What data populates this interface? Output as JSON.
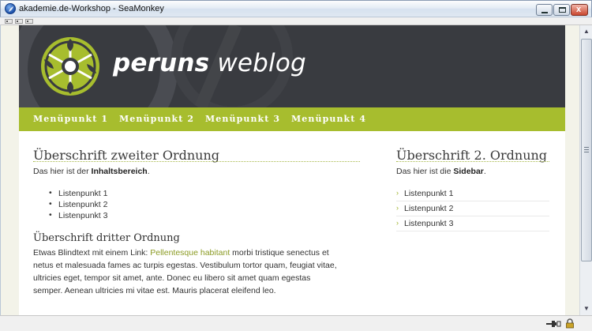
{
  "window": {
    "title": "akademie.de-Workshop - SeaMonkey",
    "close_glyph": "x"
  },
  "site": {
    "title_bold": "peruns",
    "title_rest": " weblog"
  },
  "menu": {
    "items": [
      {
        "label": "Menüpunkt 1"
      },
      {
        "label": "Menüpunkt 2"
      },
      {
        "label": "Menüpunkt 3"
      },
      {
        "label": "Menüpunkt 4"
      }
    ]
  },
  "content": {
    "heading": "Überschrift zweiter Ordnung",
    "intro_prefix": "Das hier ist der ",
    "intro_bold": "Inhaltsbereich",
    "intro_suffix": ".",
    "list": [
      "Listenpunkt 1",
      "Listenpunkt 2",
      "Listenpunkt 3"
    ],
    "subheading": "Überschrift dritter Ordnung",
    "para_line1_prefix": "Etwas Blindtext mit einem Link: ",
    "para_link": "Pellentesque habitant",
    "para_line1_suffix": " morbi tristique senectus et",
    "para_line2": "netus et malesuada fames ac turpis egestas. Vestibulum tortor quam, feugiat vitae,",
    "para_line3": "ultricies eget, tempor sit amet, ante. Donec eu libero sit amet quam egestas",
    "para_line4": "semper. Aenean ultricies mi vitae est. Mauris placerat eleifend leo."
  },
  "sidebar": {
    "heading": "Überschrift 2. Ordnung",
    "intro_prefix": "Das hier ist die ",
    "intro_bold": "Sidebar",
    "intro_suffix": ".",
    "items": [
      {
        "label": "Listenpunkt 1"
      },
      {
        "label": "Listenpunkt 2"
      },
      {
        "label": "Listenpunkt 3"
      }
    ]
  },
  "colors": {
    "header_bg": "#393b40",
    "menu_bg": "#a7bd2e",
    "link": "#8a9a22"
  },
  "icons": {
    "app": "seamonkey-icon",
    "logo": "perun-emblem-icon",
    "status_connection": "network-plug-icon",
    "status_security": "padlock-icon"
  }
}
